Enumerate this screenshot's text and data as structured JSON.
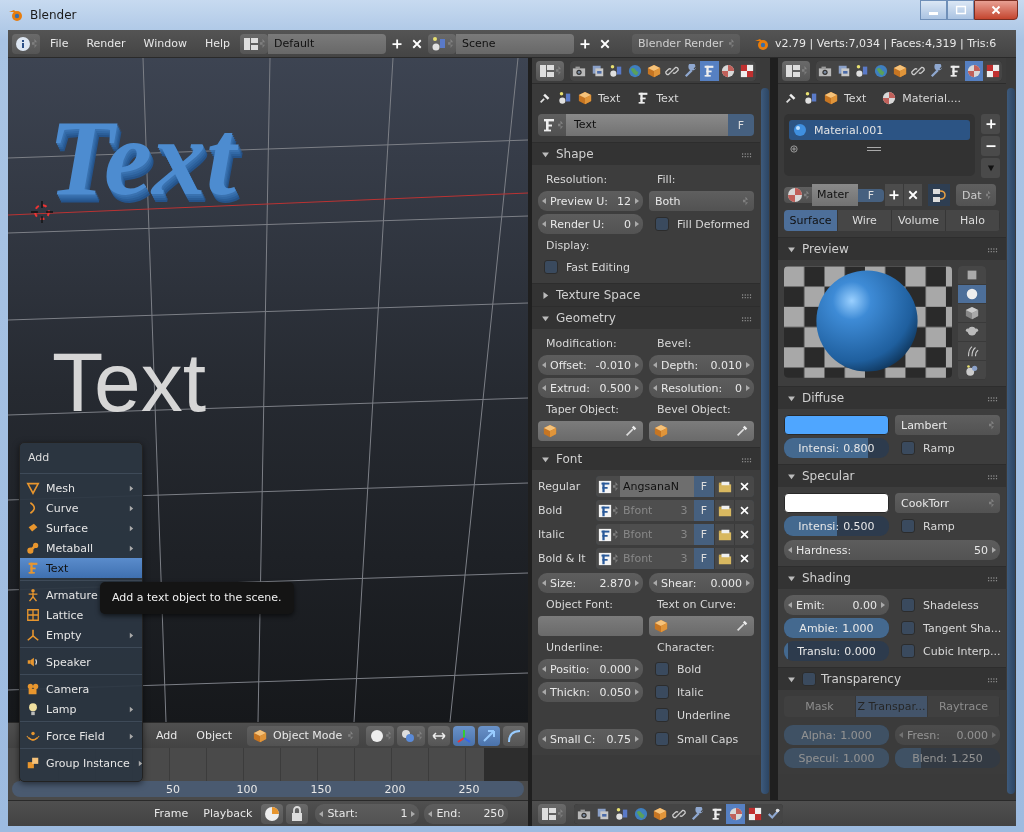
{
  "window": {
    "title": "Blender"
  },
  "header": {
    "menus": [
      "File",
      "Render",
      "Window",
      "Help"
    ],
    "layout": "Default",
    "scene": "Scene",
    "engine": "Blender Render",
    "stats": "v2.79 | Verts:7,034 | Faces:4,319 | Tris:6"
  },
  "viewport": {
    "objects": [
      {
        "kind": "extruded",
        "label": "Text"
      },
      {
        "kind": "flat",
        "label": "Text"
      }
    ],
    "menus": [
      "Add",
      "Object"
    ],
    "mode": "Object Mode"
  },
  "timeline": {
    "ruler": [
      "50",
      "100",
      "150",
      "200",
      "250"
    ],
    "menus": [
      "Frame",
      "Playback"
    ],
    "start_label": "Start:",
    "start": "1",
    "end_label": "End:",
    "end": "250"
  },
  "add_menu": {
    "title": "Add",
    "groups": [
      [
        {
          "label": "Mesh",
          "submenu": true,
          "selected": false
        },
        {
          "label": "Curve",
          "submenu": true,
          "selected": false
        },
        {
          "label": "Surface",
          "submenu": true,
          "selected": false
        },
        {
          "label": "Metaball",
          "submenu": true,
          "selected": false
        },
        {
          "label": "Text",
          "submenu": false,
          "selected": true
        }
      ],
      [
        {
          "label": "Armature",
          "submenu": false,
          "selected": false
        },
        {
          "label": "Lattice",
          "submenu": false,
          "selected": false
        },
        {
          "label": "Empty",
          "submenu": true,
          "selected": false
        }
      ],
      [
        {
          "label": "Speaker",
          "submenu": false,
          "selected": false
        }
      ],
      [
        {
          "label": "Camera",
          "submenu": false,
          "selected": false
        },
        {
          "label": "Lamp",
          "submenu": true,
          "selected": false
        }
      ],
      [
        {
          "label": "Force Field",
          "submenu": true,
          "selected": false
        }
      ],
      [
        {
          "label": "Group Instance",
          "submenu": true,
          "selected": false
        }
      ]
    ]
  },
  "tooltip": "Add a text object to the scene.",
  "data_editor": {
    "tabs": [
      {
        "selected": false
      },
      {
        "selected": false
      },
      {
        "selected": false
      },
      {
        "selected": false
      },
      {
        "selected": false
      },
      {
        "selected": false
      },
      {
        "selected": false
      },
      {
        "selected": true
      },
      {
        "selected": false
      },
      {
        "selected": false
      }
    ],
    "breadcrumb": [
      "Text",
      "Text"
    ],
    "datablock": {
      "name": "Text",
      "fake_user": "F"
    },
    "panels": [
      {
        "title": "Shape",
        "expanded": true,
        "blocks": [
          {
            "kind": "columns",
            "columns": [
              [
                {
                  "kind": "label",
                  "label": "Resolution:"
                },
                {
                  "kind": "number",
                  "label": "Preview U:",
                  "value": "12"
                },
                {
                  "kind": "number",
                  "label": "Render U:",
                  "value": "0"
                },
                {
                  "kind": "label",
                  "label": "Display:"
                },
                {
                  "kind": "checkbox",
                  "label": "Fast Editing",
                  "checked": false
                }
              ],
              [
                {
                  "kind": "label",
                  "label": "Fill:"
                },
                {
                  "kind": "dropdown",
                  "value": "Both"
                },
                {
                  "kind": "checkbox",
                  "label": "Fill Deformed",
                  "checked": false
                }
              ]
            ]
          }
        ]
      },
      {
        "title": "Texture Space",
        "expanded": false
      },
      {
        "title": "Geometry",
        "expanded": true,
        "blocks": [
          {
            "kind": "columns",
            "columns": [
              [
                {
                  "kind": "label",
                  "label": "Modification:"
                },
                {
                  "kind": "number",
                  "label": "Offset:",
                  "value": "-0.010"
                },
                {
                  "kind": "number",
                  "label": "Extrud:",
                  "value": "0.500"
                },
                {
                  "kind": "label",
                  "label": "Taper Object:"
                },
                {
                  "kind": "objfield"
                }
              ],
              [
                {
                  "kind": "label",
                  "label": "Bevel:"
                },
                {
                  "kind": "number",
                  "label": "Depth:",
                  "value": "0.010"
                },
                {
                  "kind": "number",
                  "label": "Resolution:",
                  "value": "0"
                },
                {
                  "kind": "label",
                  "label": "Bevel Object:"
                },
                {
                  "kind": "objfield"
                }
              ]
            ]
          }
        ]
      },
      {
        "title": "Font",
        "expanded": true,
        "blocks": [
          {
            "kind": "fonts",
            "fonts": [
              {
                "label": "Regular",
                "font": "AngsanaN",
                "dimmed": false,
                "fake_user": "F"
              },
              {
                "label": "Bold",
                "font": "Bfont",
                "users": "3",
                "dimmed": true,
                "fake_user": "F"
              },
              {
                "label": "Italic",
                "font": "Bfont",
                "users": "3",
                "dimmed": true,
                "fake_user": "F"
              },
              {
                "label": "Bold & It",
                "font": "Bfont",
                "users": "3",
                "dimmed": true,
                "fake_user": "F"
              }
            ]
          },
          {
            "kind": "columns",
            "columns": [
              [
                {
                  "kind": "number",
                  "label": "Size:",
                  "value": "2.870"
                },
                {
                  "kind": "label",
                  "label": "Object Font:"
                },
                {
                  "kind": "field"
                },
                {
                  "kind": "label",
                  "label": "Underline:"
                },
                {
                  "kind": "number",
                  "label": "Positio:",
                  "value": "0.000"
                },
                {
                  "kind": "number",
                  "label": "Thickn:",
                  "value": "0.050"
                }
              ],
              [
                {
                  "kind": "number",
                  "label": "Shear:",
                  "value": "0.000"
                },
                {
                  "kind": "label",
                  "label": "Text on Curve:"
                },
                {
                  "kind": "objfield"
                },
                {
                  "kind": "label",
                  "label": "Character:"
                },
                {
                  "kind": "checkbox",
                  "label": "Bold",
                  "checked": false
                },
                {
                  "kind": "checkbox",
                  "label": "Italic",
                  "checked": false
                },
                {
                  "kind": "checkbox",
                  "label": "Underline",
                  "checked": false
                }
              ]
            ]
          },
          {
            "kind": "columns",
            "columns": [
              [
                {
                  "kind": "number",
                  "label": "Small C:",
                  "value": "0.75"
                }
              ],
              [
                {
                  "kind": "checkbox",
                  "label": "Small Caps",
                  "checked": false
                }
              ]
            ]
          }
        ]
      }
    ]
  },
  "material_editor": {
    "tabs": [
      {
        "selected": false
      },
      {
        "selected": false
      },
      {
        "selected": false
      },
      {
        "selected": false
      },
      {
        "selected": false
      },
      {
        "selected": false
      },
      {
        "selected": false
      },
      {
        "selected": false
      },
      {
        "selected": true
      },
      {
        "selected": false
      }
    ],
    "breadcrumb": [
      "Text",
      "Material...."
    ],
    "slots": [
      {
        "label": "Material.001",
        "selected": true
      }
    ],
    "datablock": {
      "name": "Mater",
      "fake_user": "F",
      "link": "Dat"
    },
    "shader_tabs": [
      {
        "label": "Surface",
        "selected": true
      },
      {
        "label": "Wire",
        "selected": false
      },
      {
        "label": "Volume",
        "selected": false
      },
      {
        "label": "Halo",
        "selected": false
      }
    ],
    "panels": [
      {
        "title": "Preview",
        "expanded": true,
        "blocks": [
          {
            "kind": "preview",
            "shapes": [
              {
                "selected": false
              },
              {
                "selected": true
              },
              {
                "selected": false
              },
              {
                "selected": false
              },
              {
                "selected": false
              },
              {
                "selected": false
              }
            ]
          }
        ]
      },
      {
        "title": "Diffuse",
        "expanded": true,
        "blocks": [
          {
            "kind": "columns",
            "columns": [
              [
                {
                  "kind": "color",
                  "color": "#4fa6ff"
                },
                {
                  "kind": "slider",
                  "label": "Intensi:",
                  "value": "0.800",
                  "level": 0.8
                }
              ],
              [
                {
                  "kind": "dropdown",
                  "value": "Lambert"
                },
                {
                  "kind": "checkbox",
                  "label": "Ramp",
                  "checked": false
                }
              ]
            ]
          }
        ]
      },
      {
        "title": "Specular",
        "expanded": true,
        "blocks": [
          {
            "kind": "columns",
            "columns": [
              [
                {
                  "kind": "color",
                  "color": "#ffffff"
                },
                {
                  "kind": "slider",
                  "label": "Intensi:",
                  "value": "0.500",
                  "level": 0.5
                }
              ],
              [
                {
                  "kind": "dropdown",
                  "value": "CookTorr"
                },
                {
                  "kind": "checkbox",
                  "label": "Ramp",
                  "checked": false
                }
              ]
            ]
          },
          {
            "kind": "full",
            "item": {
              "kind": "number",
              "label": "Hardness:",
              "value": "50"
            }
          }
        ]
      },
      {
        "title": "Shading",
        "expanded": true,
        "blocks": [
          {
            "kind": "columns",
            "columns": [
              [
                {
                  "kind": "number",
                  "label": "Emit:",
                  "value": "0.00"
                },
                {
                  "kind": "slider",
                  "label": "Ambie:",
                  "value": "1.000",
                  "level": 1
                },
                {
                  "kind": "slider",
                  "label": "Translu:",
                  "value": "0.000",
                  "level": 0
                }
              ],
              [
                {
                  "kind": "checkbox",
                  "label": "Shadeless",
                  "checked": false
                },
                {
                  "kind": "checkbox",
                  "label": "Tangent Sha...",
                  "checked": false
                },
                {
                  "kind": "checkbox",
                  "label": "Cubic Interp...",
                  "checked": false
                }
              ]
            ]
          }
        ]
      },
      {
        "title": "Transparency",
        "expanded": true,
        "toggle": false,
        "disabled": true,
        "blocks": [
          {
            "kind": "segmented",
            "options": [
              {
                "label": "Mask",
                "selected": false
              },
              {
                "label": "Z Transpar...",
                "selected": true
              },
              {
                "label": "Raytrace",
                "selected": false
              }
            ]
          },
          {
            "kind": "columns",
            "columns": [
              [
                {
                  "kind": "slider",
                  "label": "Alpha:",
                  "value": "1.000",
                  "level": 1
                },
                {
                  "kind": "slider",
                  "label": "Specul:",
                  "value": "1.000",
                  "level": 1
                }
              ],
              [
                {
                  "kind": "number",
                  "label": "Fresn:",
                  "value": "0.000"
                },
                {
                  "kind": "slider",
                  "label": "Blend:",
                  "value": "1.250",
                  "level": 0.25
                }
              ]
            ]
          }
        ]
      }
    ]
  },
  "bottom_tabs": [
    {
      "selected": false
    },
    {
      "selected": false
    },
    {
      "selected": false
    },
    {
      "selected": false
    },
    {
      "selected": false
    },
    {
      "selected": false
    },
    {
      "selected": false
    },
    {
      "selected": false
    },
    {
      "selected": true
    },
    {
      "selected": false
    },
    {
      "selected": false
    }
  ]
}
